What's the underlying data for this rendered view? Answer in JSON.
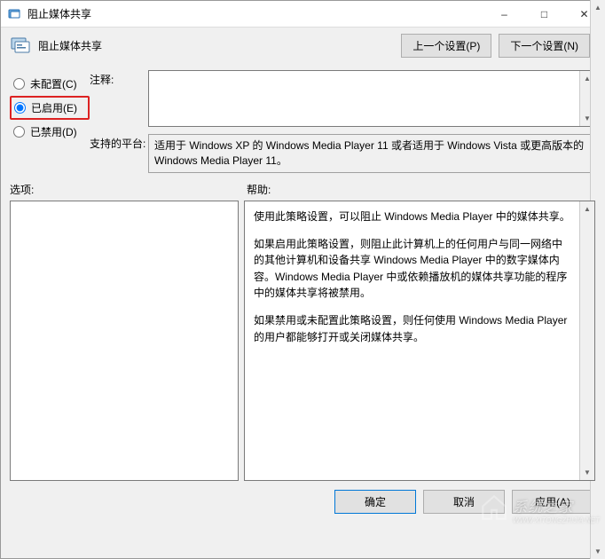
{
  "window": {
    "title": "阻止媒体共享"
  },
  "header": {
    "title": "阻止媒体共享",
    "prev_btn": "上一个设置(P)",
    "next_btn": "下一个设置(N)"
  },
  "radios": {
    "not_configured": "未配置(C)",
    "enabled": "已启用(E)",
    "disabled": "已禁用(D)",
    "selected": "enabled"
  },
  "fields": {
    "comment_label": "注释:",
    "comment_value": "",
    "platform_label": "支持的平台:",
    "platform_value": "适用于 Windows XP 的 Windows Media Player 11 或者适用于 Windows Vista 或更高版本的 Windows Media Player 11。"
  },
  "sections": {
    "options_label": "选项:",
    "help_label": "帮助:"
  },
  "help": {
    "p1": "使用此策略设置，可以阻止 Windows Media Player 中的媒体共享。",
    "p2": "如果启用此策略设置，则阻止此计算机上的任何用户与同一网络中的其他计算机和设备共享 Windows Media Player 中的数字媒体内容。Windows Media Player 中或依赖播放机的媒体共享功能的程序中的媒体共享将被禁用。",
    "p3": "如果禁用或未配置此策略设置，则任何使用 Windows Media Player 的用户都能够打开或关闭媒体共享。"
  },
  "footer": {
    "ok": "确定",
    "cancel": "取消",
    "apply": "应用(A)"
  },
  "watermark": {
    "text": "系统之家",
    "url": "WWW.XITONGZHIJIA.NET"
  }
}
